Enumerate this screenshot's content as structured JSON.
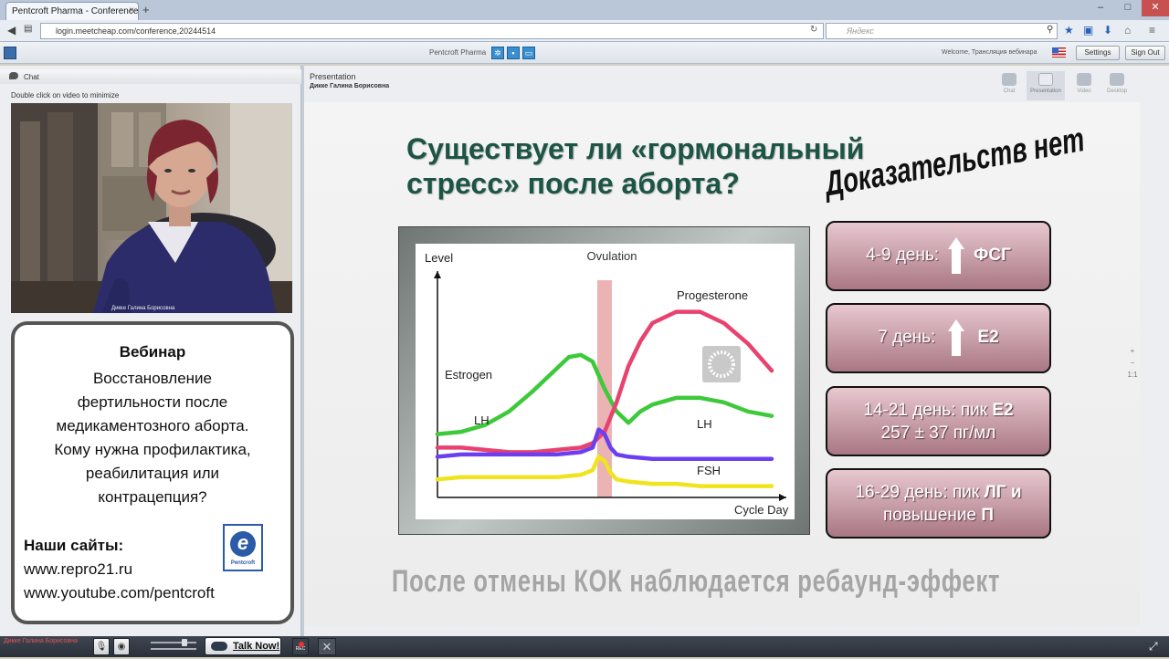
{
  "browser": {
    "tab_title": "Pentcroft Pharma - Conference...",
    "tab_close": "×",
    "new_tab": "+",
    "url": "login.meetcheap.com/conference,20244514",
    "search_placeholder": "Яндекс",
    "window_controls": [
      "–",
      "□",
      "✕"
    ]
  },
  "app": {
    "title": "Pentcroft Pharma",
    "welcome": "Welcome, Трансляция вебинара",
    "settings_label": "Settings",
    "signout_label": "Sign Out"
  },
  "left": {
    "chat_label": "Chat",
    "video_hint": "Double click on video to minimize",
    "video_caption": "Дикке Галина Борисовна",
    "promo": {
      "title": "Вебинар",
      "body_lines": [
        "Восстановление",
        "фертильности после",
        "медикаментозного аборта.",
        "Кому нужна профилактика,",
        "реабилитация или",
        "контрацепция?"
      ],
      "sites_heading": "Наши сайты:",
      "sites": [
        "www.repro21.ru",
        "www.youtube.com/pentcroft"
      ],
      "logo_word": "Pentcroft",
      "logo_letter": "e"
    }
  },
  "presentation": {
    "label": "Presentation",
    "presenter": "Дикке Галина Борисовна",
    "modes": [
      {
        "label": "Chat",
        "active": false
      },
      {
        "label": "Presentation",
        "active": true
      },
      {
        "label": "Video",
        "active": false
      },
      {
        "label": "Desktop",
        "active": false
      }
    ],
    "zoom": [
      "+",
      "−",
      "1:1"
    ]
  },
  "slide": {
    "title_line1": "Существует ли «гормональный",
    "title_line2": "стресс» после аборта?",
    "stamp": "Доказательств нет",
    "badges": [
      {
        "prefix": "4-9 день:",
        "value": "ФСГ",
        "arrow": true
      },
      {
        "prefix": "7 день:",
        "value": "E2",
        "arrow": true
      },
      {
        "line1_prefix": "14-21 день: пик ",
        "line1_bold": "E2",
        "line2": "257 ± 37 пг/мл"
      },
      {
        "line1_prefix": "16-29 день: пик ",
        "line1_bold": "ЛГ и",
        "line2_prefix": "повышение ",
        "line2_bold": "П"
      }
    ],
    "footer": "После отмены КОК наблюдается ребаунд-эффект"
  },
  "chart_data": {
    "type": "line",
    "xlabel": "Cycle Day",
    "ylabel": "Level",
    "ylim": [
      0,
      100
    ],
    "xlim": [
      0,
      28
    ],
    "marker": {
      "label": "Ovulation",
      "x": 14,
      "color": "#e8a6a6"
    },
    "series": [
      {
        "name": "Estrogen",
        "color": "#3ec93a",
        "x": [
          0,
          2,
          4,
          6,
          8,
          10,
          11,
          12,
          13,
          14,
          15,
          16,
          17,
          18,
          20,
          22,
          24,
          26,
          28
        ],
        "y": [
          28,
          29,
          32,
          38,
          47,
          57,
          62,
          63,
          60,
          48,
          38,
          33,
          38,
          41,
          44,
          44,
          42,
          38,
          36
        ]
      },
      {
        "name": "Progesterone",
        "color": "#e8426f",
        "x": [
          0,
          2,
          4,
          6,
          8,
          10,
          12,
          13,
          14,
          15,
          16,
          17,
          18,
          20,
          22,
          24,
          26,
          28
        ],
        "y": [
          22,
          22,
          21,
          20,
          20,
          21,
          22,
          24,
          29,
          42,
          58,
          69,
          77,
          82,
          82,
          77,
          68,
          56
        ]
      },
      {
        "name": "LH",
        "color": "#6b3ff0",
        "x": [
          0,
          2,
          4,
          6,
          8,
          10,
          12,
          13,
          13.5,
          14,
          14.5,
          15,
          16,
          18,
          20,
          22,
          24,
          26,
          28
        ],
        "y": [
          18,
          19,
          19,
          19,
          19,
          19,
          20,
          22,
          30,
          28,
          22,
          19,
          18,
          17,
          17,
          17,
          17,
          17,
          17
        ]
      },
      {
        "name": "FSH",
        "color": "#f0e41f",
        "x": [
          0,
          2,
          4,
          6,
          8,
          10,
          12,
          13,
          13.5,
          14,
          14.5,
          15,
          16,
          18,
          20,
          22,
          24,
          26,
          28
        ],
        "y": [
          8,
          9,
          9,
          9,
          9,
          9,
          10,
          12,
          18,
          16,
          11,
          8,
          7,
          6,
          6,
          5,
          5,
          5,
          5
        ]
      }
    ],
    "labels": [
      {
        "text": "Estrogen",
        "series": "Estrogen"
      },
      {
        "text": "Progesterone",
        "series": "Progesterone"
      },
      {
        "text": "LH",
        "series": "LH"
      },
      {
        "text": "LH",
        "series": "LH"
      },
      {
        "text": "FSH",
        "series": "FSH"
      }
    ]
  },
  "bottom": {
    "presenter_name": "Дикке Галина Борисовна",
    "talk_label": "Talk Now!",
    "rec_label": "REC",
    "close_label": "✕"
  }
}
